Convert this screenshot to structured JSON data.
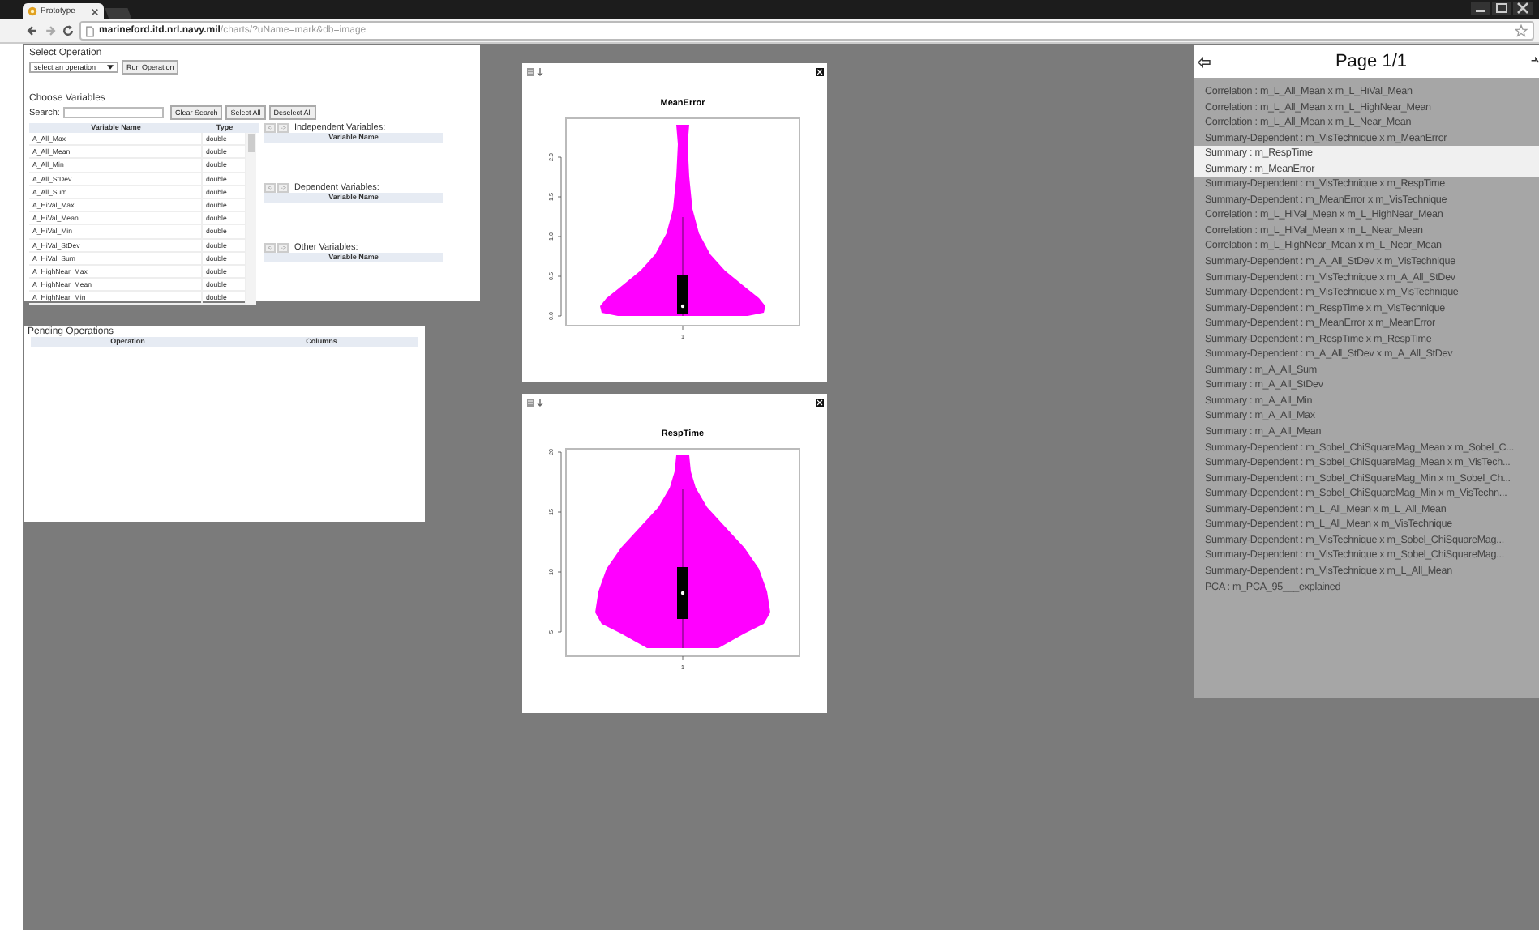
{
  "browser": {
    "tab_title": "Prototype",
    "url_host": "marineford.itd.nrl.navy.mil",
    "url_path": "/charts/?uName=mark&db=image"
  },
  "operation_panel": {
    "heading": "Select Operation",
    "select": {
      "value": "select an operation"
    },
    "run_button": "Run Operation",
    "choose_heading": "Choose Variables",
    "search_label": "Search:",
    "buttons": [
      "Clear Search",
      "Select All",
      "Deselect All"
    ],
    "columns": [
      "Variable Name",
      "Type"
    ],
    "rows": [
      {
        "name": "A_All_Max",
        "type": "double"
      },
      {
        "name": "A_All_Mean",
        "type": "double"
      },
      {
        "name": "A_All_Min",
        "type": "double"
      },
      {
        "name": "A_All_StDev",
        "type": "double"
      },
      {
        "name": "A_All_Sum",
        "type": "double"
      },
      {
        "name": "A_HiVal_Max",
        "type": "double"
      },
      {
        "name": "A_HiVal_Mean",
        "type": "double"
      },
      {
        "name": "A_HiVal_Min",
        "type": "double"
      },
      {
        "name": "A_HiVal_StDev",
        "type": "double"
      },
      {
        "name": "A_HiVal_Sum",
        "type": "double"
      },
      {
        "name": "A_HighNear_Max",
        "type": "double"
      },
      {
        "name": "A_HighNear_Mean",
        "type": "double"
      },
      {
        "name": "A_HighNear_Min",
        "type": "double"
      }
    ],
    "groups": [
      {
        "label": "Independent Variables:",
        "column": "Variable Name",
        "left": "<-",
        "right": "->"
      },
      {
        "label": "Dependent Variables:",
        "column": "Variable Name",
        "left": "<-",
        "right": "->"
      },
      {
        "label": "Other Variables:",
        "column": "Variable Name",
        "left": "<-",
        "right": "->"
      }
    ]
  },
  "pending_panel": {
    "heading": "Pending Operations",
    "columns": [
      "Operation",
      "Columns"
    ]
  },
  "charts": [
    {
      "title": "MeanError",
      "y_tick_labels": [
        "0.0",
        "0.5",
        "1.0",
        "1.5",
        "2.0"
      ],
      "x_tick_label": "1"
    },
    {
      "title": "RespTime",
      "y_tick_labels": [
        "5",
        "10",
        "15",
        "20"
      ],
      "x_tick_label": "1"
    }
  ],
  "results": {
    "heading": "Page 1/1",
    "items": [
      {
        "text": "Correlation : m_L_All_Mean x m_L_HiVal_Mean",
        "selected": false
      },
      {
        "text": "Correlation : m_L_All_Mean x m_L_HighNear_Mean",
        "selected": false
      },
      {
        "text": "Correlation : m_L_All_Mean x m_L_Near_Mean",
        "selected": false
      },
      {
        "text": "Summary-Dependent : m_VisTechnique x m_MeanError",
        "selected": false
      },
      {
        "text": "Summary : m_RespTime",
        "selected": true
      },
      {
        "text": "Summary : m_MeanError",
        "selected": true
      },
      {
        "text": "Summary-Dependent : m_VisTechnique x m_RespTime",
        "selected": false
      },
      {
        "text": "Summary-Dependent : m_MeanError x m_VisTechnique",
        "selected": false
      },
      {
        "text": "Correlation : m_L_HiVal_Mean x m_L_HighNear_Mean",
        "selected": false
      },
      {
        "text": "Correlation : m_L_HiVal_Mean x m_L_Near_Mean",
        "selected": false
      },
      {
        "text": "Correlation : m_L_HighNear_Mean x m_L_Near_Mean",
        "selected": false
      },
      {
        "text": "Summary-Dependent : m_A_All_StDev x m_VisTechnique",
        "selected": false
      },
      {
        "text": "Summary-Dependent : m_VisTechnique x m_A_All_StDev",
        "selected": false
      },
      {
        "text": "Summary-Dependent : m_VisTechnique x m_VisTechnique",
        "selected": false
      },
      {
        "text": "Summary-Dependent : m_RespTime x m_VisTechnique",
        "selected": false
      },
      {
        "text": "Summary-Dependent : m_MeanError x m_MeanError",
        "selected": false
      },
      {
        "text": "Summary-Dependent : m_RespTime x m_RespTime",
        "selected": false
      },
      {
        "text": "Summary-Dependent : m_A_All_StDev x m_A_All_StDev",
        "selected": false
      },
      {
        "text": "Summary : m_A_All_Sum",
        "selected": false
      },
      {
        "text": "Summary : m_A_All_StDev",
        "selected": false
      },
      {
        "text": "Summary : m_A_All_Min",
        "selected": false
      },
      {
        "text": "Summary : m_A_All_Max",
        "selected": false
      },
      {
        "text": "Summary : m_A_All_Mean",
        "selected": false
      },
      {
        "text": "Summary-Dependent : m_Sobel_ChiSquareMag_Mean x m_Sobel_C...",
        "selected": false
      },
      {
        "text": "Summary-Dependent : m_Sobel_ChiSquareMag_Mean x m_VisTech...",
        "selected": false
      },
      {
        "text": "Summary-Dependent : m_Sobel_ChiSquareMag_Min x m_Sobel_Ch...",
        "selected": false
      },
      {
        "text": "Summary-Dependent : m_Sobel_ChiSquareMag_Min x m_VisTechn...",
        "selected": false
      },
      {
        "text": "Summary-Dependent : m_L_All_Mean x m_L_All_Mean",
        "selected": false
      },
      {
        "text": "Summary-Dependent : m_L_All_Mean x m_VisTechnique",
        "selected": false
      },
      {
        "text": "Summary-Dependent : m_VisTechnique x m_Sobel_ChiSquareMag...",
        "selected": false
      },
      {
        "text": "Summary-Dependent : m_VisTechnique x m_Sobel_ChiSquareMag...",
        "selected": false
      },
      {
        "text": "Summary-Dependent : m_VisTechnique x m_L_All_Mean",
        "selected": false
      },
      {
        "text": "PCA : m_PCA_95___explained",
        "selected": false
      }
    ]
  }
}
